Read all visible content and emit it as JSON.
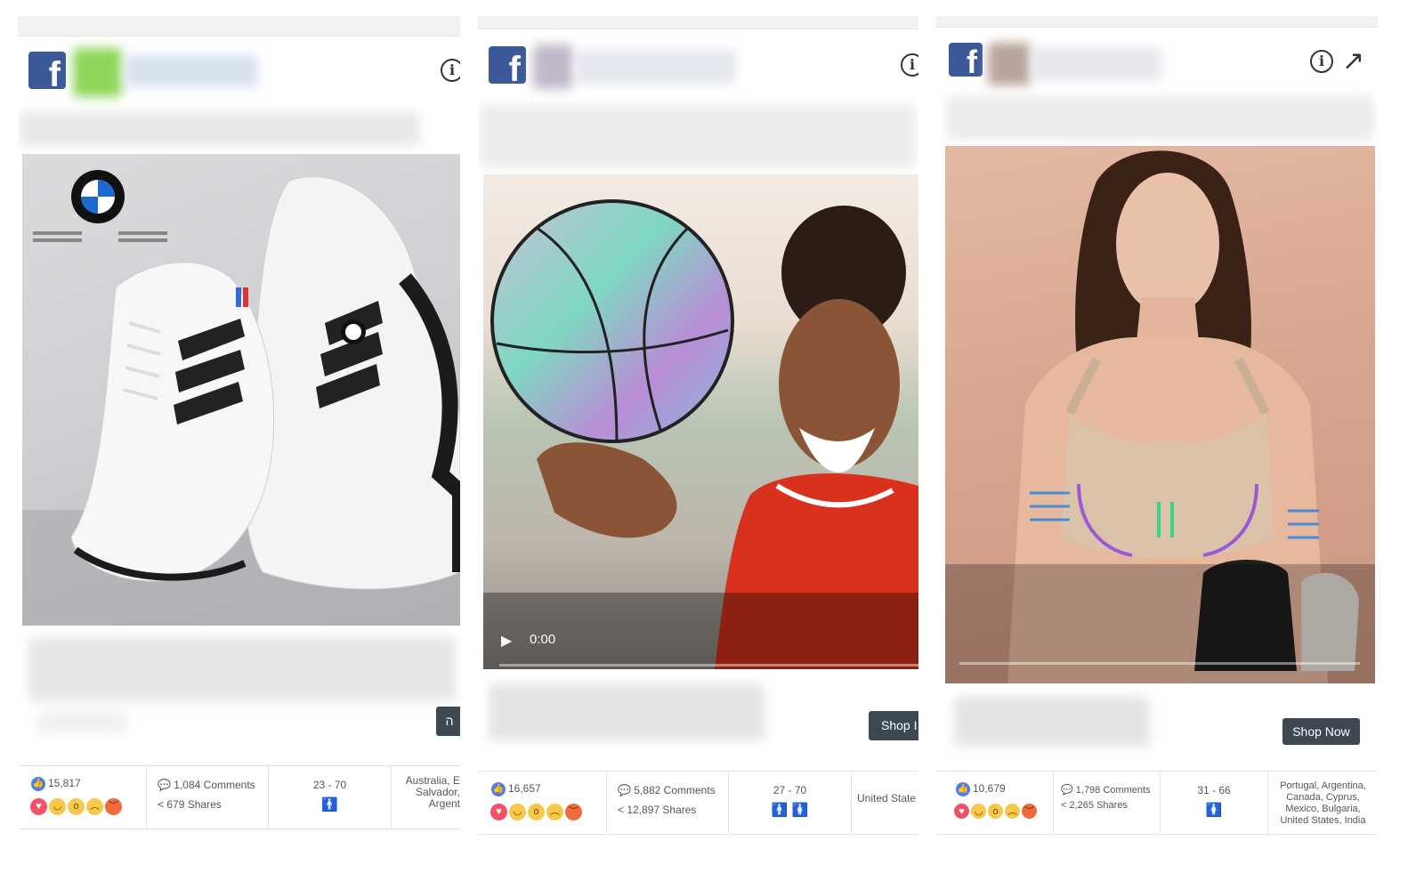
{
  "ads": [
    {
      "cta_label": "ה",
      "likes": "15,817",
      "comments": "1,084 Comments",
      "shares": "679 Shares",
      "age_range": "23 - 70",
      "countries": "Australia, E\nSalvador,\nArgent"
    },
    {
      "video_time": "0:00",
      "cta_label": "Shop I",
      "likes": "16,657",
      "comments": "5,882 Comments",
      "shares": "12,897 Shares",
      "age_range": "27 - 70",
      "countries": "United State"
    },
    {
      "cta_label": "Shop Now",
      "likes": "10,679",
      "comments": "1,798 Comments",
      "shares": "2,265 Shares",
      "age_range": "31 - 66",
      "countries": "Portugal, Argentina,\nCanada, Cyprus,\nMexico, Bulgaria,\nUnited States, India"
    }
  ],
  "icons": {
    "facebook": "facebook-logo-icon",
    "info": "info-icon",
    "external": "external-link-icon",
    "like": "like-icon",
    "comment": "comment-icon",
    "share": "share-icon",
    "male": "male-icon",
    "female": "female-icon",
    "play": "play-icon"
  },
  "colors": {
    "facebook_blue": "#3b5998",
    "cta_bg": "#3d4852",
    "like_blue": "#4a7ee8",
    "love_red": "#f25268",
    "female_pink": "#e68ee8"
  }
}
